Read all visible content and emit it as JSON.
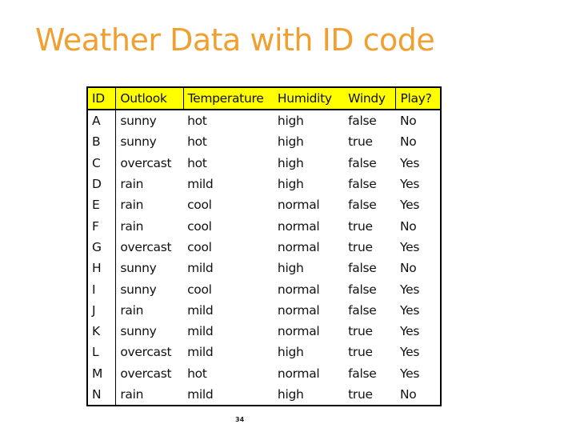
{
  "slide": {
    "title": "Weather Data with ID code",
    "page_number": "34"
  },
  "colors": {
    "title": "#f0a030",
    "header_background": "#ffff00",
    "border": "#000000"
  },
  "table": {
    "headers": [
      "ID",
      "Outlook",
      "Temperature",
      "Humidity",
      "Windy",
      "Play?"
    ],
    "rows": [
      [
        "A",
        "sunny",
        "hot",
        "high",
        "false",
        "No"
      ],
      [
        "B",
        "sunny",
        "hot",
        "high",
        "true",
        "No"
      ],
      [
        "C",
        "overcast",
        "hot",
        "high",
        "false",
        "Yes"
      ],
      [
        "D",
        "rain",
        "mild",
        "high",
        "false",
        "Yes"
      ],
      [
        "E",
        "rain",
        "cool",
        "normal",
        "false",
        "Yes"
      ],
      [
        "F",
        "rain",
        "cool",
        "normal",
        "true",
        "No"
      ],
      [
        "G",
        "overcast",
        "cool",
        "normal",
        "true",
        "Yes"
      ],
      [
        "H",
        "sunny",
        "mild",
        "high",
        "false",
        "No"
      ],
      [
        "I",
        "sunny",
        "cool",
        "normal",
        "false",
        "Yes"
      ],
      [
        "J",
        "rain",
        "mild",
        "normal",
        "false",
        "Yes"
      ],
      [
        "K",
        "sunny",
        "mild",
        "normal",
        "true",
        "Yes"
      ],
      [
        "L",
        "overcast",
        "mild",
        "high",
        "true",
        "Yes"
      ],
      [
        "M",
        "overcast",
        "hot",
        "normal",
        "false",
        "Yes"
      ],
      [
        "N",
        "rain",
        "mild",
        "high",
        "true",
        "No"
      ]
    ]
  }
}
